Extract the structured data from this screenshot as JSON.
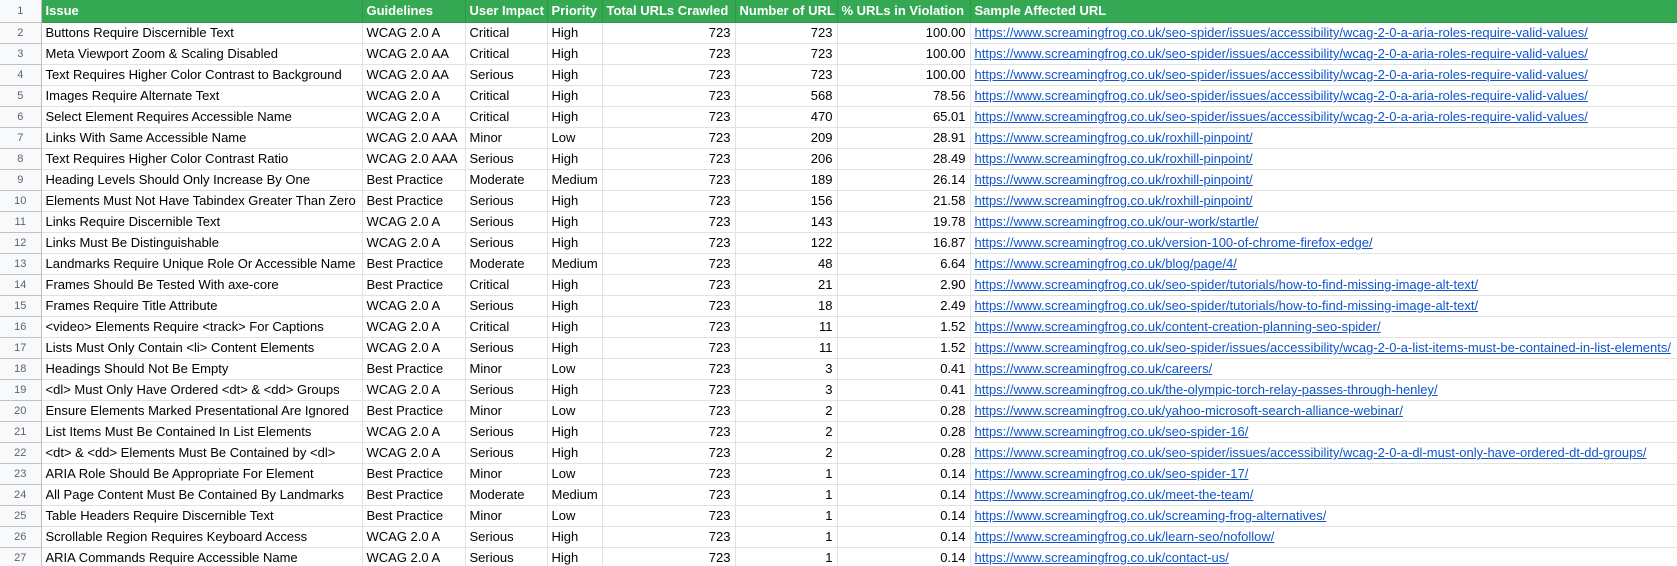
{
  "columns": [
    "Issue",
    "Guidelines",
    "User Impact",
    "Priority",
    "Total URLs Crawled",
    "Number of URL",
    "% URLs in Violation",
    "Sample Affected URL"
  ],
  "header_row_number": "1",
  "colors": {
    "header_bg": "#34a853",
    "header_text": "#ffffff",
    "link": "#1155cc",
    "gridline": "#e2e2e2"
  },
  "rows": [
    {
      "num": "2",
      "issue": "Buttons Require Discernible Text",
      "guidelines": "WCAG 2.0 A",
      "impact": "Critical",
      "priority": "High",
      "total": "723",
      "count": "723",
      "pct": "100.00",
      "url": "https://www.screamingfrog.co.uk/seo-spider/issues/accessibility/wcag-2-0-a-aria-roles-require-valid-values/"
    },
    {
      "num": "3",
      "issue": "Meta Viewport Zoom & Scaling Disabled",
      "guidelines": "WCAG 2.0 AA",
      "impact": "Critical",
      "priority": "High",
      "total": "723",
      "count": "723",
      "pct": "100.00",
      "url": "https://www.screamingfrog.co.uk/seo-spider/issues/accessibility/wcag-2-0-a-aria-roles-require-valid-values/"
    },
    {
      "num": "4",
      "issue": "Text Requires Higher Color Contrast to Background",
      "guidelines": "WCAG 2.0 AA",
      "impact": "Serious",
      "priority": "High",
      "total": "723",
      "count": "723",
      "pct": "100.00",
      "url": "https://www.screamingfrog.co.uk/seo-spider/issues/accessibility/wcag-2-0-a-aria-roles-require-valid-values/"
    },
    {
      "num": "5",
      "issue": "Images Require Alternate Text",
      "guidelines": "WCAG 2.0 A",
      "impact": "Critical",
      "priority": "High",
      "total": "723",
      "count": "568",
      "pct": "78.56",
      "url": "https://www.screamingfrog.co.uk/seo-spider/issues/accessibility/wcag-2-0-a-aria-roles-require-valid-values/"
    },
    {
      "num": "6",
      "issue": "Select Element Requires Accessible Name",
      "guidelines": "WCAG 2.0 A",
      "impact": "Critical",
      "priority": "High",
      "total": "723",
      "count": "470",
      "pct": "65.01",
      "url": "https://www.screamingfrog.co.uk/seo-spider/issues/accessibility/wcag-2-0-a-aria-roles-require-valid-values/"
    },
    {
      "num": "7",
      "issue": "Links With Same Accessible Name",
      "guidelines": "WCAG 2.0 AAA",
      "impact": "Minor",
      "priority": "Low",
      "total": "723",
      "count": "209",
      "pct": "28.91",
      "url": "https://www.screamingfrog.co.uk/roxhill-pinpoint/"
    },
    {
      "num": "8",
      "issue": "Text Requires Higher Color Contrast Ratio",
      "guidelines": "WCAG 2.0 AAA",
      "impact": "Serious",
      "priority": "High",
      "total": "723",
      "count": "206",
      "pct": "28.49",
      "url": "https://www.screamingfrog.co.uk/roxhill-pinpoint/"
    },
    {
      "num": "9",
      "issue": "Heading Levels Should Only Increase By One",
      "guidelines": "Best Practice",
      "impact": "Moderate",
      "priority": "Medium",
      "total": "723",
      "count": "189",
      "pct": "26.14",
      "url": "https://www.screamingfrog.co.uk/roxhill-pinpoint/"
    },
    {
      "num": "10",
      "issue": "Elements Must Not Have Tabindex Greater Than Zero",
      "guidelines": "Best Practice",
      "impact": "Serious",
      "priority": "High",
      "total": "723",
      "count": "156",
      "pct": "21.58",
      "url": "https://www.screamingfrog.co.uk/roxhill-pinpoint/"
    },
    {
      "num": "11",
      "issue": "Links Require Discernible Text",
      "guidelines": "WCAG 2.0 A",
      "impact": "Serious",
      "priority": "High",
      "total": "723",
      "count": "143",
      "pct": "19.78",
      "url": "https://www.screamingfrog.co.uk/our-work/startle/"
    },
    {
      "num": "12",
      "issue": "Links Must Be Distinguishable",
      "guidelines": "WCAG 2.0 A",
      "impact": "Serious",
      "priority": "High",
      "total": "723",
      "count": "122",
      "pct": "16.87",
      "url": "https://www.screamingfrog.co.uk/version-100-of-chrome-firefox-edge/"
    },
    {
      "num": "13",
      "issue": "Landmarks Require Unique Role Or Accessible Name",
      "guidelines": "Best Practice",
      "impact": "Moderate",
      "priority": "Medium",
      "total": "723",
      "count": "48",
      "pct": "6.64",
      "url": "https://www.screamingfrog.co.uk/blog/page/4/"
    },
    {
      "num": "14",
      "issue": "Frames Should Be Tested With axe-core",
      "guidelines": "Best Practice",
      "impact": "Critical",
      "priority": "High",
      "total": "723",
      "count": "21",
      "pct": "2.90",
      "url": "https://www.screamingfrog.co.uk/seo-spider/tutorials/how-to-find-missing-image-alt-text/"
    },
    {
      "num": "15",
      "issue": "Frames Require Title Attribute",
      "guidelines": "WCAG 2.0 A",
      "impact": "Serious",
      "priority": "High",
      "total": "723",
      "count": "18",
      "pct": "2.49",
      "url": "https://www.screamingfrog.co.uk/seo-spider/tutorials/how-to-find-missing-image-alt-text/"
    },
    {
      "num": "16",
      "issue": "<video> Elements Require <track> For Captions",
      "guidelines": "WCAG 2.0 A",
      "impact": "Critical",
      "priority": "High",
      "total": "723",
      "count": "11",
      "pct": "1.52",
      "url": "https://www.screamingfrog.co.uk/content-creation-planning-seo-spider/"
    },
    {
      "num": "17",
      "issue": "Lists Must Only Contain <li> Content Elements",
      "guidelines": "WCAG 2.0 A",
      "impact": "Serious",
      "priority": "High",
      "total": "723",
      "count": "11",
      "pct": "1.52",
      "url": "https://www.screamingfrog.co.uk/seo-spider/issues/accessibility/wcag-2-0-a-list-items-must-be-contained-in-list-elements/"
    },
    {
      "num": "18",
      "issue": "Headings Should Not Be Empty",
      "guidelines": "Best Practice",
      "impact": "Minor",
      "priority": "Low",
      "total": "723",
      "count": "3",
      "pct": "0.41",
      "url": "https://www.screamingfrog.co.uk/careers/"
    },
    {
      "num": "19",
      "issue": "<dl> Must Only Have Ordered <dt> & <dd> Groups",
      "guidelines": "WCAG 2.0 A",
      "impact": "Serious",
      "priority": "High",
      "total": "723",
      "count": "3",
      "pct": "0.41",
      "url": "https://www.screamingfrog.co.uk/the-olympic-torch-relay-passes-through-henley/"
    },
    {
      "num": "20",
      "issue": "Ensure Elements Marked Presentational Are Ignored",
      "guidelines": "Best Practice",
      "impact": "Minor",
      "priority": "Low",
      "total": "723",
      "count": "2",
      "pct": "0.28",
      "url": "https://www.screamingfrog.co.uk/yahoo-microsoft-search-alliance-webinar/"
    },
    {
      "num": "21",
      "issue": "List Items Must Be Contained In List Elements",
      "guidelines": "WCAG 2.0 A",
      "impact": "Serious",
      "priority": "High",
      "total": "723",
      "count": "2",
      "pct": "0.28",
      "url": "https://www.screamingfrog.co.uk/seo-spider-16/"
    },
    {
      "num": "22",
      "issue": "<dt> & <dd> Elements Must Be Contained by <dl>",
      "guidelines": "WCAG 2.0 A",
      "impact": "Serious",
      "priority": "High",
      "total": "723",
      "count": "2",
      "pct": "0.28",
      "url": "https://www.screamingfrog.co.uk/seo-spider/issues/accessibility/wcag-2-0-a-dl-must-only-have-ordered-dt-dd-groups/"
    },
    {
      "num": "23",
      "issue": "ARIA Role Should Be Appropriate For Element",
      "guidelines": "Best Practice",
      "impact": "Minor",
      "priority": "Low",
      "total": "723",
      "count": "1",
      "pct": "0.14",
      "url": "https://www.screamingfrog.co.uk/seo-spider-17/"
    },
    {
      "num": "24",
      "issue": "All Page Content Must Be Contained By Landmarks",
      "guidelines": "Best Practice",
      "impact": "Moderate",
      "priority": "Medium",
      "total": "723",
      "count": "1",
      "pct": "0.14",
      "url": "https://www.screamingfrog.co.uk/meet-the-team/"
    },
    {
      "num": "25",
      "issue": "Table Headers Require Discernible Text",
      "guidelines": "Best Practice",
      "impact": "Minor",
      "priority": "Low",
      "total": "723",
      "count": "1",
      "pct": "0.14",
      "url": "https://www.screamingfrog.co.uk/screaming-frog-alternatives/"
    },
    {
      "num": "26",
      "issue": "Scrollable Region Requires Keyboard Access",
      "guidelines": "WCAG 2.0 A",
      "impact": "Serious",
      "priority": "High",
      "total": "723",
      "count": "1",
      "pct": "0.14",
      "url": "https://www.screamingfrog.co.uk/learn-seo/nofollow/"
    },
    {
      "num": "27",
      "issue": "ARIA Commands Require Accessible Name",
      "guidelines": "WCAG 2.0 A",
      "impact": "Serious",
      "priority": "High",
      "total": "723",
      "count": "1",
      "pct": "0.14",
      "url": "https://www.screamingfrog.co.uk/contact-us/"
    }
  ]
}
